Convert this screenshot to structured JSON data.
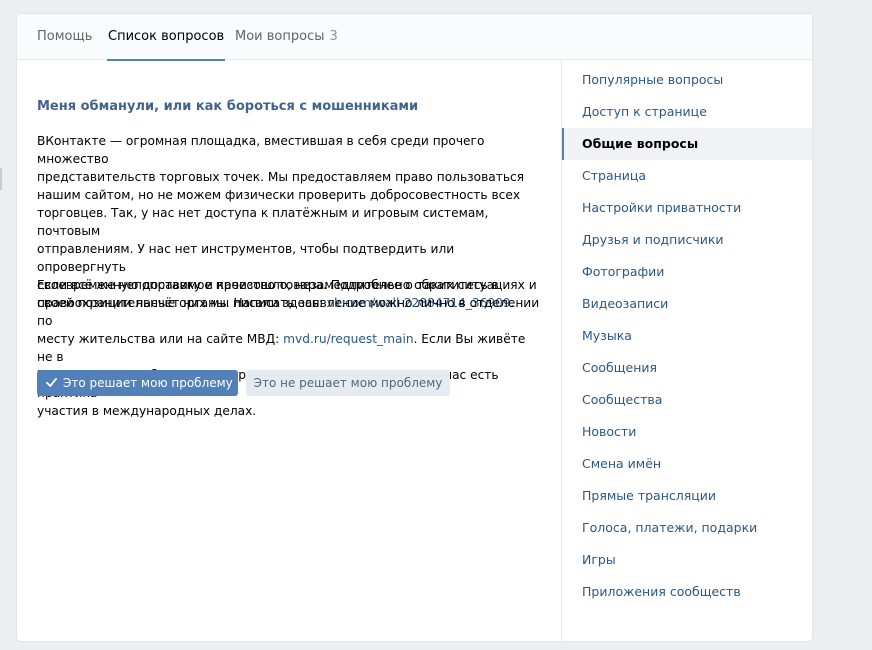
{
  "tabs": [
    {
      "label": "Помощь"
    },
    {
      "label": "Список вопросов"
    },
    {
      "label": "Мои вопросы",
      "count": "3"
    }
  ],
  "question": {
    "title": "Меня обманули, или как бороться с мошенниками",
    "para1_lines": [
      "ВКонтакте — огромная площадка, вместившая в себя среди прочего множество",
      "представительств торговых точек. Мы предоставляем право пользоваться",
      "нашим сайтом, но не можем физически проверить добросовестность всех",
      "торговцев. Так, у нас нет доступа к платёжным и игровым системам, почтовым",
      "отправлениям. У нас нет инструментов, чтобы подтвердить или опровергнуть",
      "своевременную доставку и качество товара. Подробнее о таких ситуациях и"
    ],
    "para1_last_prefix": "своей позиции насчёт них мы писали здесь: ",
    "para1_link": "vk.com/wall-22884714_36909",
    "para1_last_suffix": ".",
    "para2_lines": [
      "Если всё же непоправимое произошло, незамедлительно обратитесь в",
      "правоохранительные органы. Написать заявление можно лично в отделении по"
    ],
    "para2_mid_prefix": "месту жительства или на сайте МВД: ",
    "para2_link": "mvd.ru/request_main",
    "para2_mid_suffix": ". Если Вы живёте не в",
    "para2_end_lines": [
      "России, можете обратиться в органы по месту жительства – у нас есть практика",
      "участия в международных делах."
    ]
  },
  "buttons": {
    "solves": "Это решает мою проблему",
    "not_solves": "Это не решает мою проблему"
  },
  "sidebar": {
    "items": [
      {
        "label": "Популярные вопросы"
      },
      {
        "label": "Доступ к странице"
      },
      {
        "label": "Общие вопросы",
        "selected": true
      },
      {
        "label": "Страница"
      },
      {
        "label": "Настройки приватности"
      },
      {
        "label": "Друзья и подписчики"
      },
      {
        "label": "Фотографии"
      },
      {
        "label": "Видеозаписи"
      },
      {
        "label": "Музыка"
      },
      {
        "label": "Сообщения"
      },
      {
        "label": "Сообщества"
      },
      {
        "label": "Новости"
      },
      {
        "label": "Смена имён"
      },
      {
        "label": "Прямые трансляции"
      },
      {
        "label": "Голоса, платежи, подарки"
      },
      {
        "label": "Игры"
      },
      {
        "label": "Приложения сообществ"
      }
    ]
  },
  "colors": {
    "accent": "#5181b8",
    "link": "#2a5885",
    "title": "#42648b",
    "page_bg": "#edeef0"
  },
  "icons": {
    "solves_button_icon": "checkmark-icon"
  }
}
